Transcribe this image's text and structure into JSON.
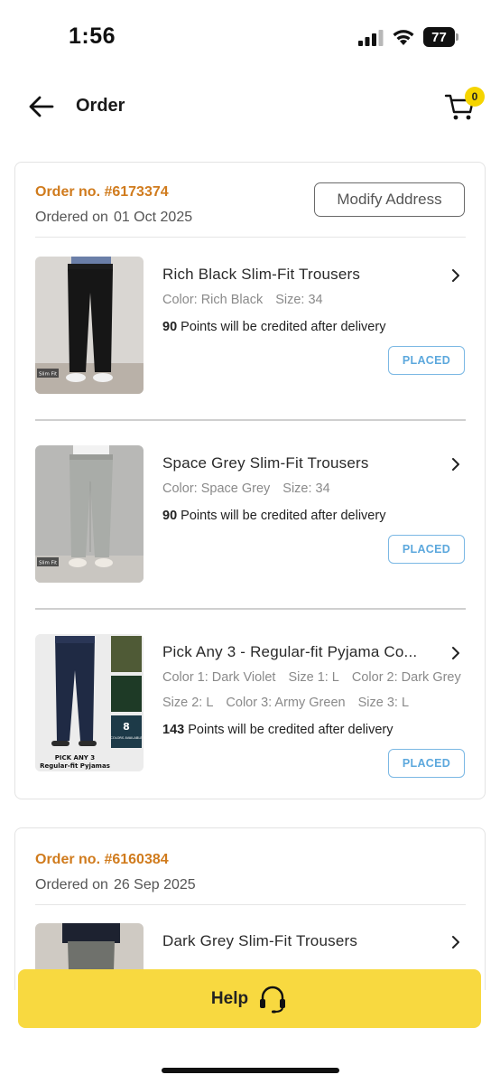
{
  "status_bar": {
    "time": "1:56",
    "battery": "77"
  },
  "header": {
    "title": "Order",
    "cart_count": "0"
  },
  "orders": [
    {
      "order_no": "Order no. #6173374",
      "ordered_on_label": "Ordered on",
      "ordered_on_date": "01 Oct 2025",
      "modify_label": "Modify Address",
      "items": [
        {
          "name": "Rich Black Slim-Fit Trousers",
          "meta_line1": [
            "Color: Rich Black",
            "Size: 34"
          ],
          "points": "90",
          "points_text": " Points will be credited after delivery",
          "status": "PLACED",
          "thumb_label": "Slim Fit"
        },
        {
          "name": "Space Grey Slim-Fit Trousers",
          "meta_line1": [
            "Color: Space Grey",
            "Size: 34"
          ],
          "points": "90",
          "points_text": " Points will be credited after delivery",
          "status": "PLACED",
          "thumb_label": "Slim Fit"
        },
        {
          "name": "Pick Any 3 - Regular-fit Pyjama Co...",
          "meta_line1": [
            "Color 1: Dark Violet",
            "Size 1: L",
            "Color 2: Dark Grey"
          ],
          "meta_line2": [
            "Size 2: L",
            "Color 3: Army Green",
            "Size 3: L"
          ],
          "points": "143",
          "points_text": " Points will be credited after delivery",
          "status": "PLACED",
          "thumb_label_top": "PICK ANY 3",
          "thumb_label_bottom": "Regular-fit Pyjamas",
          "thumb_count": "8",
          "thumb_count_label": "COLORS AVAILABLE"
        }
      ]
    },
    {
      "order_no": "Order no. #6160384",
      "ordered_on_label": "Ordered on",
      "ordered_on_date": "26 Sep 2025",
      "items": [
        {
          "name": "Dark Grey Slim-Fit Trousers"
        }
      ]
    }
  ],
  "help": {
    "label": "Help"
  },
  "colors": {
    "accent_yellow": "#f8d940",
    "order_orange": "#d07b1d",
    "status_blue": "#5ca8dd"
  }
}
